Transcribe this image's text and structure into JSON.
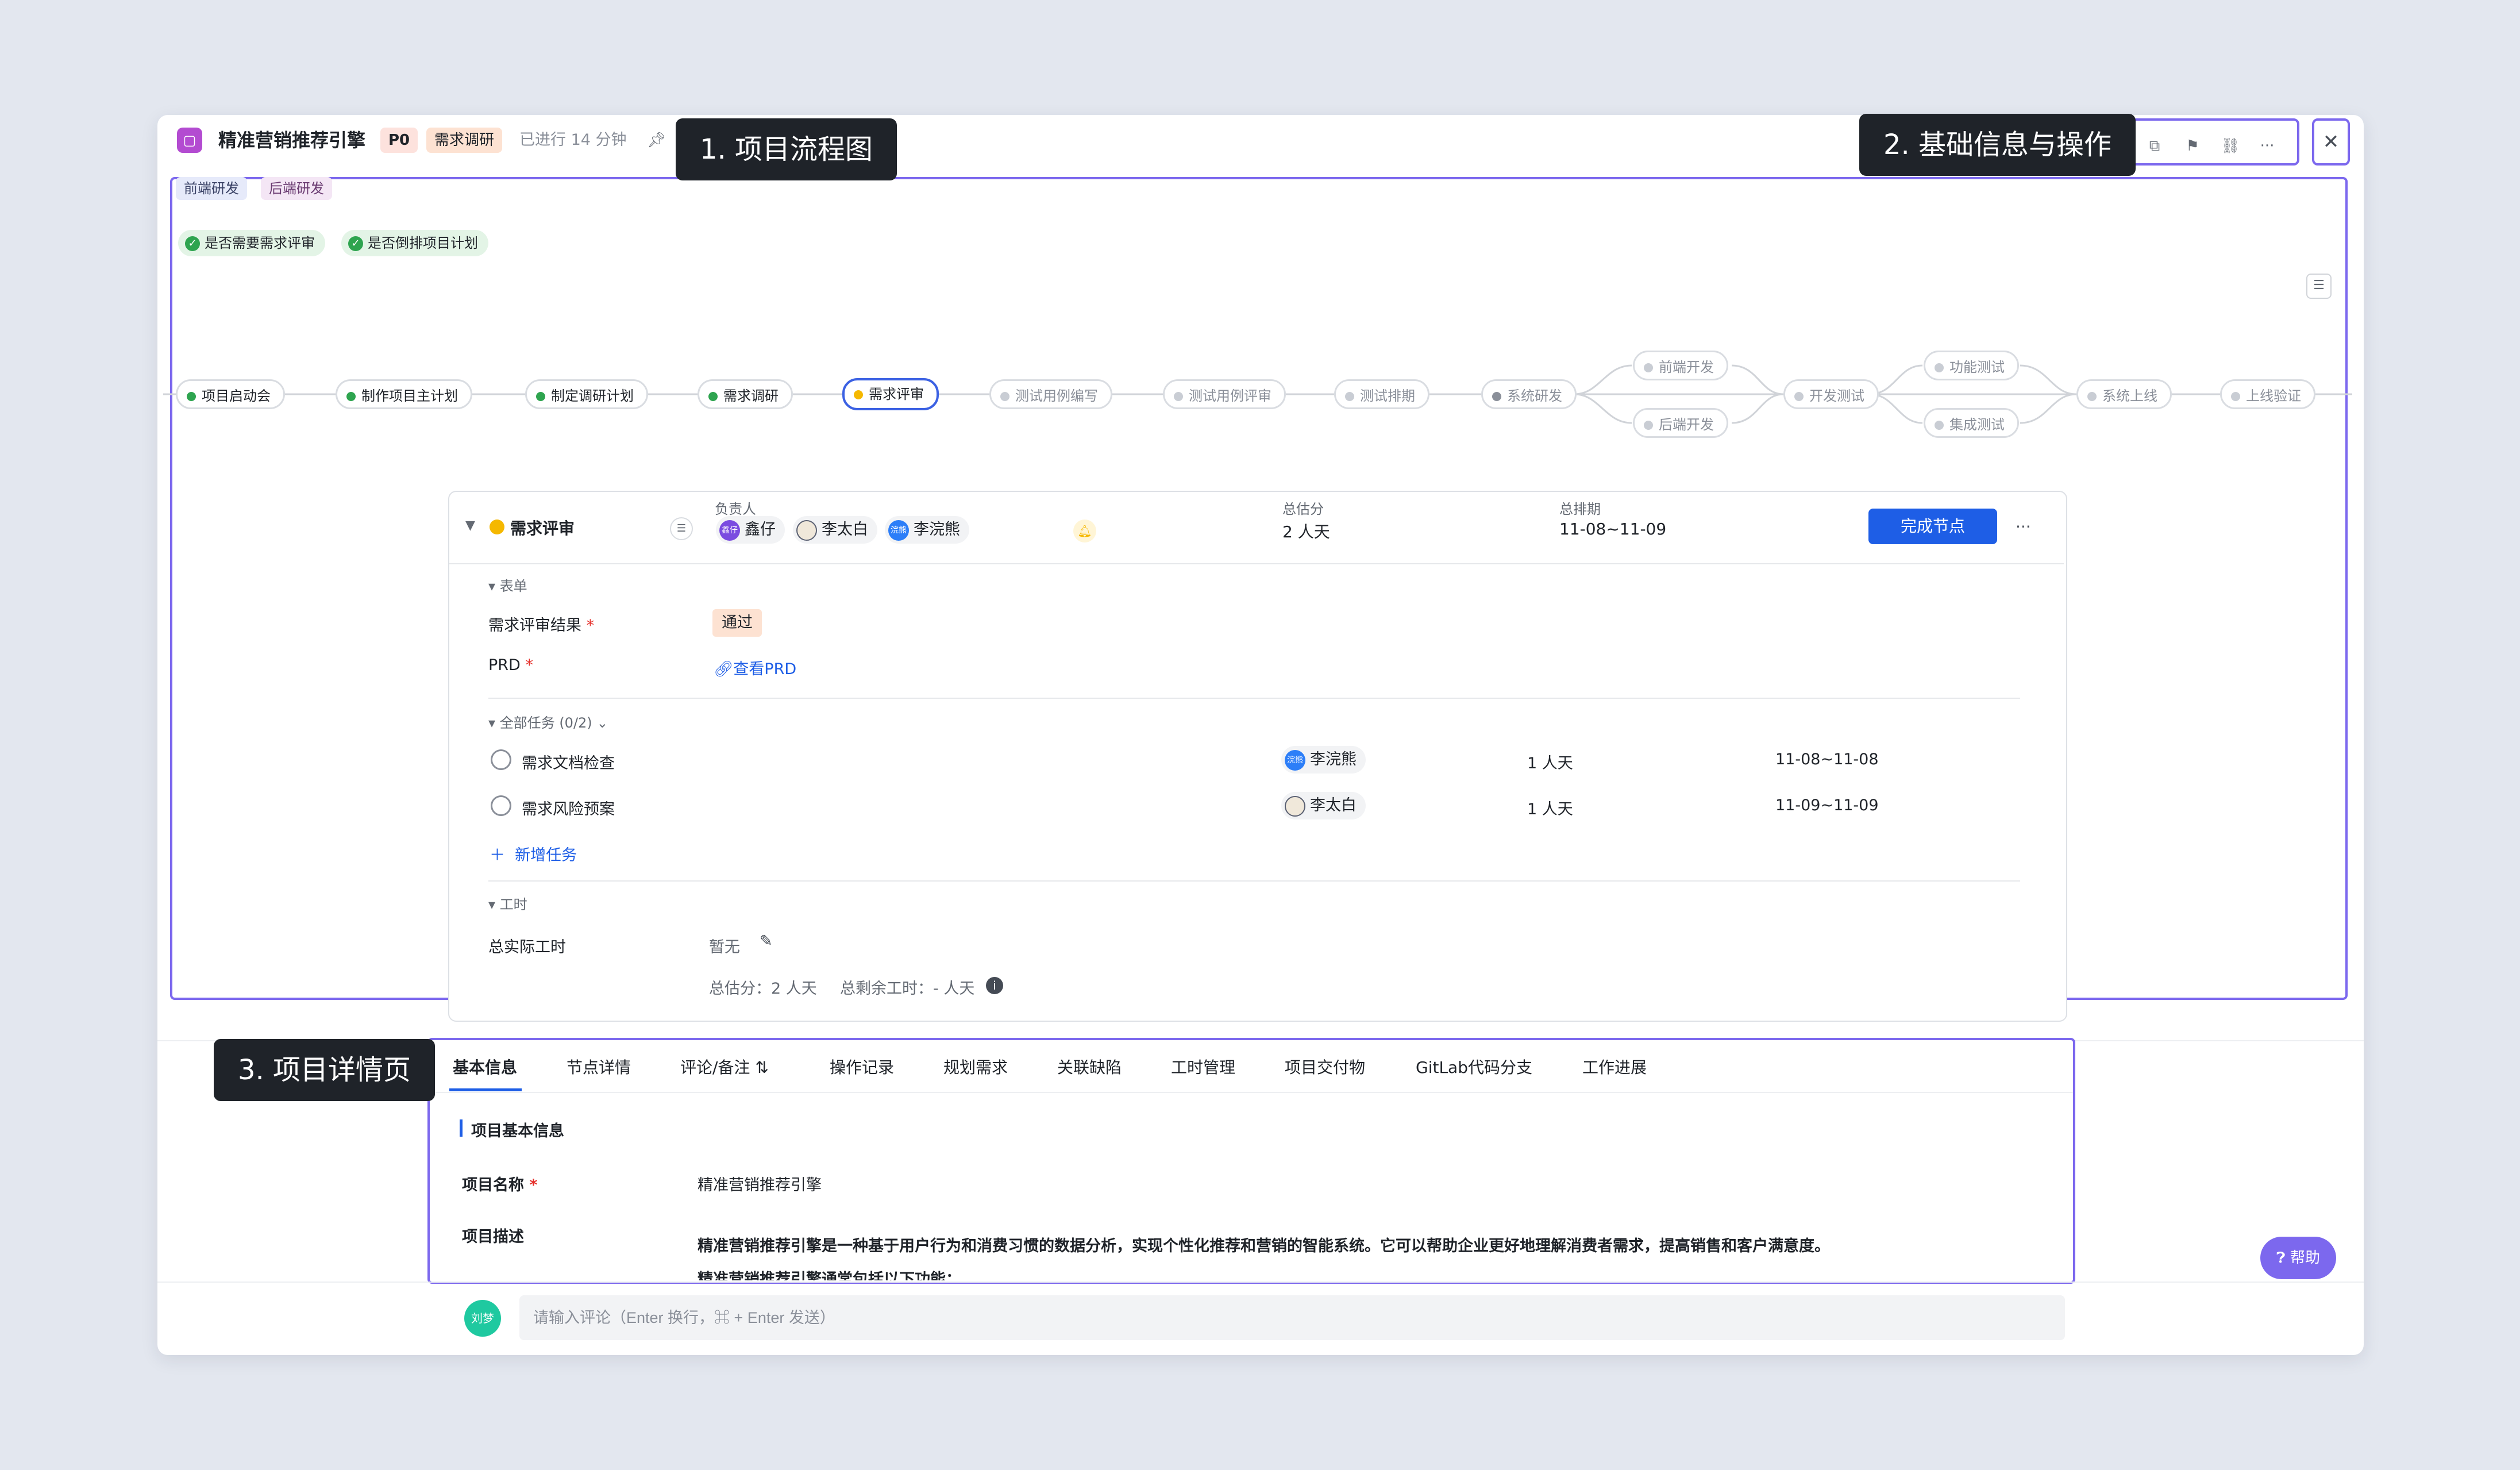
{
  "header": {
    "app_icon": "document-icon",
    "title": "精准营销推荐引擎",
    "priority": "P0",
    "stage": "需求调研",
    "elapsed": "已进行 14 分钟",
    "pin_icon": "pin-icon",
    "actions": [
      "copy-icon",
      "bookmark-icon",
      "link-icon",
      "more-icon"
    ],
    "close_icon": "close-icon"
  },
  "callouts": {
    "flow": "1. 项目流程图",
    "info": "2. 基础信息与操作",
    "detail": "3. 项目详情页"
  },
  "flow": {
    "swimlanes": [
      "前端研发",
      "后端研发"
    ],
    "conditions": [
      "是否需要需求评审",
      "是否倒排项目计划"
    ],
    "nodes": [
      {
        "label": "项目启动会",
        "status": "done"
      },
      {
        "label": "制作项目主计划",
        "status": "done"
      },
      {
        "label": "制定调研计划",
        "status": "done"
      },
      {
        "label": "需求调研",
        "status": "done"
      },
      {
        "label": "需求评审",
        "status": "active"
      },
      {
        "label": "测试用例编写",
        "status": "todo"
      },
      {
        "label": "测试用例评审",
        "status": "todo"
      },
      {
        "label": "测试排期",
        "status": "todo"
      },
      {
        "label": "系统研发",
        "status": "todo"
      },
      {
        "label": "前端开发",
        "status": "todo"
      },
      {
        "label": "后端开发",
        "status": "todo"
      },
      {
        "label": "开发测试",
        "status": "todo"
      },
      {
        "label": "功能测试",
        "status": "todo"
      },
      {
        "label": "集成测试",
        "status": "todo"
      },
      {
        "label": "系统上线",
        "status": "todo"
      },
      {
        "label": "上线验证",
        "status": "todo"
      }
    ]
  },
  "card": {
    "node_name": "需求评审",
    "owner_label": "负责人",
    "owners": [
      {
        "name": "鑫仔",
        "avatar": "鑫仔"
      },
      {
        "name": "李太白",
        "avatar": ""
      },
      {
        "name": "李浣熊",
        "avatar": "浣熊"
      }
    ],
    "estimate_label": "总估分",
    "estimate": "2 人天",
    "schedule_label": "总排期",
    "schedule": "11-08~11-09",
    "complete_button": "完成节点",
    "form_section": "表单",
    "review_result_label": "需求评审结果",
    "review_result": "通过",
    "prd_label": "PRD",
    "prd_link": "查看PRD",
    "tasks_section": "全部任务 (0/2)",
    "tasks": [
      {
        "name": "需求文档检查",
        "owner": "李浣熊",
        "owner_avatar": "浣熊",
        "effort": "1 人天",
        "date": "11-08~11-08"
      },
      {
        "name": "需求风险预案",
        "owner": "李太白",
        "owner_avatar": "",
        "effort": "1 人天",
        "date": "11-09~11-09"
      }
    ],
    "add_task": "新增任务",
    "hours_section": "工时",
    "actual_hours_label": "总实际工时",
    "actual_hours": "暂无",
    "summary_estimate": "总估分：2 人天",
    "summary_remaining": "总剩余工时：- 人天"
  },
  "tabs": [
    "基本信息",
    "节点详情",
    "评论/备注",
    "操作记录",
    "规划需求",
    "关联缺陷",
    "工时管理",
    "项目交付物",
    "GitLab代码分支",
    "工作进展"
  ],
  "basic": {
    "section_title": "项目基本信息",
    "name_label": "项目名称",
    "name_value": "精准营销推荐引擎",
    "desc_label": "项目描述",
    "desc_line1": "精准营销推荐引擎是一种基于用户行为和消费习惯的数据分析，实现个性化推荐和营销的智能系统。它可以帮助企业更好地理解消费者需求，提高销售和客户满意度。",
    "desc_line2": "精准营销推荐引擎通常包括以下功能："
  },
  "help": "帮助",
  "comment": {
    "avatar": "刘梦",
    "placeholder": "请输入评论（Enter 换行，⌘ + Enter 发送）"
  },
  "colors": {
    "accent": "#1e5ee6",
    "frame": "#7c68ee",
    "done": "#2ea44f",
    "active": "#f5b800"
  }
}
